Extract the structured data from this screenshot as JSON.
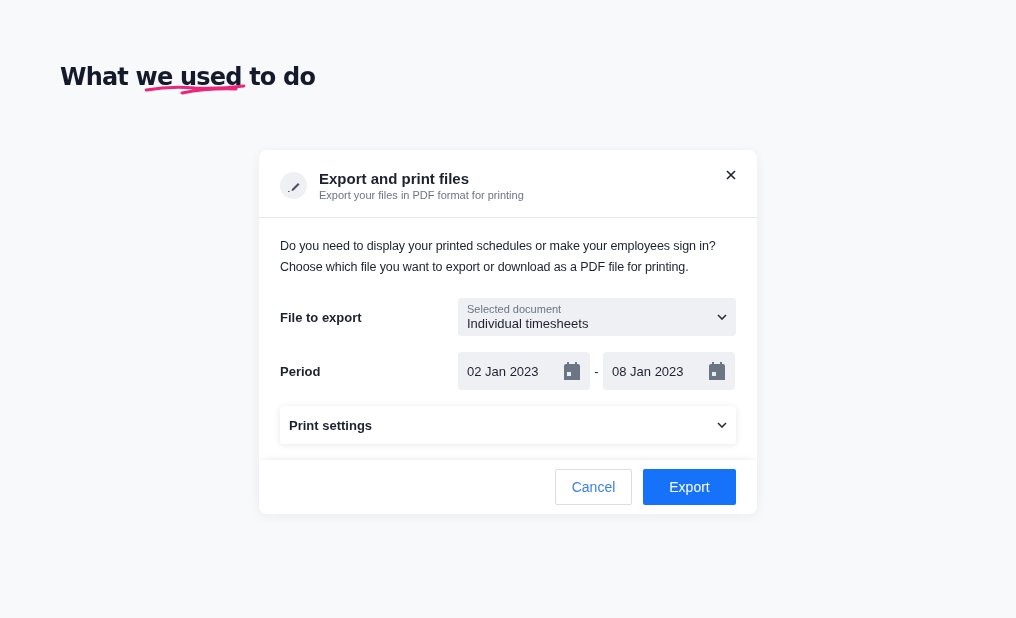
{
  "heading": {
    "parts": [
      {
        "text": "What ",
        "underlined": false
      },
      {
        "text": "we used",
        "underlined": true
      },
      {
        "text": " to do",
        "underlined": false
      }
    ]
  },
  "dialog": {
    "title": "Export and print files",
    "subtitle": "Export your files in PDF format for printing",
    "description": "Do you need to display your printed schedules or make your employees sign in? Choose which file you want to export or download as a PDF file for printing.",
    "file_field": {
      "label": "File to export",
      "floating_label": "Selected document",
      "value": "Individual timesheets"
    },
    "period": {
      "label": "Period",
      "start": "02 Jan 2023",
      "separator": "-",
      "end": "08 Jan 2023"
    },
    "print_settings": {
      "label": "Print settings",
      "expanded": false
    },
    "buttons": [
      {
        "label": "Cancel",
        "kind": "secondary"
      },
      {
        "label": "Export",
        "kind": "primary"
      }
    ]
  }
}
